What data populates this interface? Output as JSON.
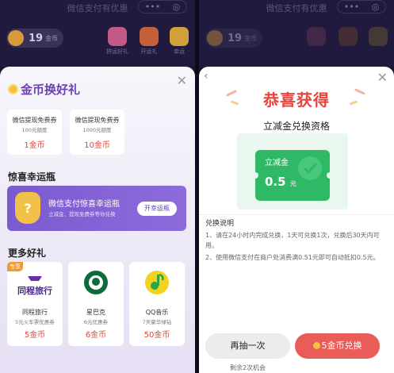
{
  "left": {
    "app_title": "微信支付有优惠",
    "capsule": {
      "menu": "•••",
      "target": "◎"
    },
    "coin_count": "19",
    "coin_unit": "金币",
    "top_icons": [
      "拼运好礼",
      "开运礼",
      "幸运"
    ],
    "sheet": {
      "title": "金币换好礼",
      "exchange_cards": [
        {
          "name": "微信提现免费券",
          "desc": "100元额度",
          "price": "1金币"
        },
        {
          "name": "微信提现免费券",
          "desc": "1000元额度",
          "price": "10金币"
        }
      ],
      "section_bottle": "惊喜幸运瓶",
      "banner": {
        "title": "微信支付惊喜幸运瓶",
        "subtitle": "立减金、提现免费券等你兑换",
        "button": "开幸运瓶"
      },
      "section_more": "更多好礼",
      "gifts": [
        {
          "tag": "专享",
          "logo_text": "同程旅行",
          "name": "同程旅行",
          "desc": "5元火车票优惠券",
          "price": "5金币"
        },
        {
          "tag": "",
          "logo_text": "",
          "name": "星巴克",
          "desc": "6元优惠券",
          "price": "6金币"
        },
        {
          "tag": "",
          "logo_text": "",
          "name": "QQ音乐",
          "desc": "7天豪华绿钻",
          "price": "50金币"
        }
      ]
    }
  },
  "right": {
    "app_title": "微信支付有优惠",
    "capsule": {
      "menu": "•••",
      "target": "◎"
    },
    "coin_count": "19",
    "coin_unit": "金币",
    "congrats": "恭喜获得",
    "prize_title": "立减金兑换资格",
    "coupon": {
      "label": "立减金",
      "value": "0.5",
      "unit": "元"
    },
    "rules_heading": "兑换说明",
    "rules": [
      "1、请在24小时内完成兑换，1天可兑换1次，兑换后30天内可用。",
      "2、使用微信支付在商户处消费满0.51元即可自动抵扣0.5元。"
    ],
    "draw_again": "再抽一次",
    "exchange_button": "5金币兑换",
    "remaining": "剩余2次机会"
  },
  "colors": {
    "accent_red": "#e6463a",
    "purple": "#6b3fb0",
    "green": "#2fb866"
  }
}
